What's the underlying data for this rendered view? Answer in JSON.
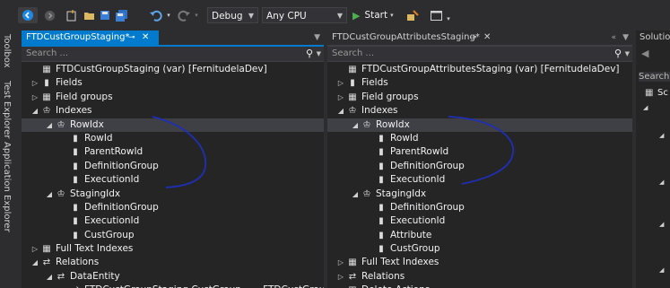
{
  "toolbar": {
    "config": "Debug",
    "platform": "Any CPU",
    "start": "Start",
    "icons": [
      "nav-back-icon",
      "nav-forward-icon",
      "new-project-icon",
      "open-icon",
      "save-icon",
      "save-all-icon",
      "undo-icon",
      "redo-icon",
      "start-icon",
      "find-icon",
      "window-icon"
    ]
  },
  "side_tabs": [
    "Toolbox",
    "Test Explorer",
    "Application Explorer"
  ],
  "left_panel": {
    "tab": "FTDCustGroupStaging*",
    "search_placeholder": "Search ...",
    "rows": [
      {
        "text": "FTDCustGroupStaging (var) [FernitudelaDev]",
        "indent": 0,
        "exp": "",
        "icon": "▦"
      },
      {
        "text": "Fields",
        "indent": 0,
        "exp": "▷",
        "icon": "▮"
      },
      {
        "text": "Field groups",
        "indent": 0,
        "exp": "▷",
        "icon": "▦"
      },
      {
        "text": "Indexes",
        "indent": 0,
        "exp": "◢",
        "icon": "♔"
      },
      {
        "text": "RowIdx",
        "indent": 1,
        "exp": "◢",
        "icon": "♔",
        "sel": true
      },
      {
        "text": "RowId",
        "indent": 2,
        "exp": "",
        "icon": "▮"
      },
      {
        "text": "ParentRowId",
        "indent": 2,
        "exp": "",
        "icon": "▮"
      },
      {
        "text": "DefinitionGroup",
        "indent": 2,
        "exp": "",
        "icon": "▮"
      },
      {
        "text": "ExecutionId",
        "indent": 2,
        "exp": "",
        "icon": "▮"
      },
      {
        "text": "StagingIdx",
        "indent": 1,
        "exp": "◢",
        "icon": "♔"
      },
      {
        "text": "DefinitionGroup",
        "indent": 2,
        "exp": "",
        "icon": "▮"
      },
      {
        "text": "ExecutionId",
        "indent": 2,
        "exp": "",
        "icon": "▮"
      },
      {
        "text": "CustGroup",
        "indent": 2,
        "exp": "",
        "icon": "▮"
      },
      {
        "text": "Full Text Indexes",
        "indent": 0,
        "exp": "▷",
        "icon": "▦"
      },
      {
        "text": "Relations",
        "indent": 0,
        "exp": "◢",
        "icon": "⇄"
      },
      {
        "text": "DataEntity",
        "indent": 1,
        "exp": "◢",
        "icon": "⇄"
      },
      {
        "text": "FTDCustGroupStaging.CustGroup == FTDCustGroupEntity",
        "indent": 2,
        "exp": "",
        "icon": "⇄"
      }
    ]
  },
  "right_panel": {
    "tab": "FTDCustGroupAttributesStaging*",
    "search_placeholder": "Search ...",
    "rows": [
      {
        "text": "FTDCustGroupAttributesStaging (var) [FernitudelaDev]",
        "indent": 0,
        "exp": "",
        "icon": "▦"
      },
      {
        "text": "Fields",
        "indent": 0,
        "exp": "▷",
        "icon": "▮"
      },
      {
        "text": "Field groups",
        "indent": 0,
        "exp": "▷",
        "icon": "▦"
      },
      {
        "text": "Indexes",
        "indent": 0,
        "exp": "◢",
        "icon": "♔"
      },
      {
        "text": "RowIdx",
        "indent": 1,
        "exp": "◢",
        "icon": "♔",
        "sel": true
      },
      {
        "text": "RowId",
        "indent": 2,
        "exp": "",
        "icon": "▮"
      },
      {
        "text": "ParentRowId",
        "indent": 2,
        "exp": "",
        "icon": "▮"
      },
      {
        "text": "DefinitionGroup",
        "indent": 2,
        "exp": "",
        "icon": "▮"
      },
      {
        "text": "ExecutionId",
        "indent": 2,
        "exp": "",
        "icon": "▮"
      },
      {
        "text": "StagingIdx",
        "indent": 1,
        "exp": "◢",
        "icon": "♔"
      },
      {
        "text": "DefinitionGroup",
        "indent": 2,
        "exp": "",
        "icon": "▮"
      },
      {
        "text": "ExecutionId",
        "indent": 2,
        "exp": "",
        "icon": "▮"
      },
      {
        "text": "Attribute",
        "indent": 2,
        "exp": "",
        "icon": "▮"
      },
      {
        "text": "CustGroup",
        "indent": 2,
        "exp": "",
        "icon": "▮"
      },
      {
        "text": "Full Text Indexes",
        "indent": 0,
        "exp": "▷",
        "icon": "▦"
      },
      {
        "text": "Relations",
        "indent": 0,
        "exp": "▷",
        "icon": "⇄"
      },
      {
        "text": "Delete Actions",
        "indent": 0,
        "exp": "▷",
        "icon": "▦"
      }
    ]
  },
  "solution_panel": {
    "title": "Solutio",
    "search": "Search",
    "item": "Sc"
  }
}
